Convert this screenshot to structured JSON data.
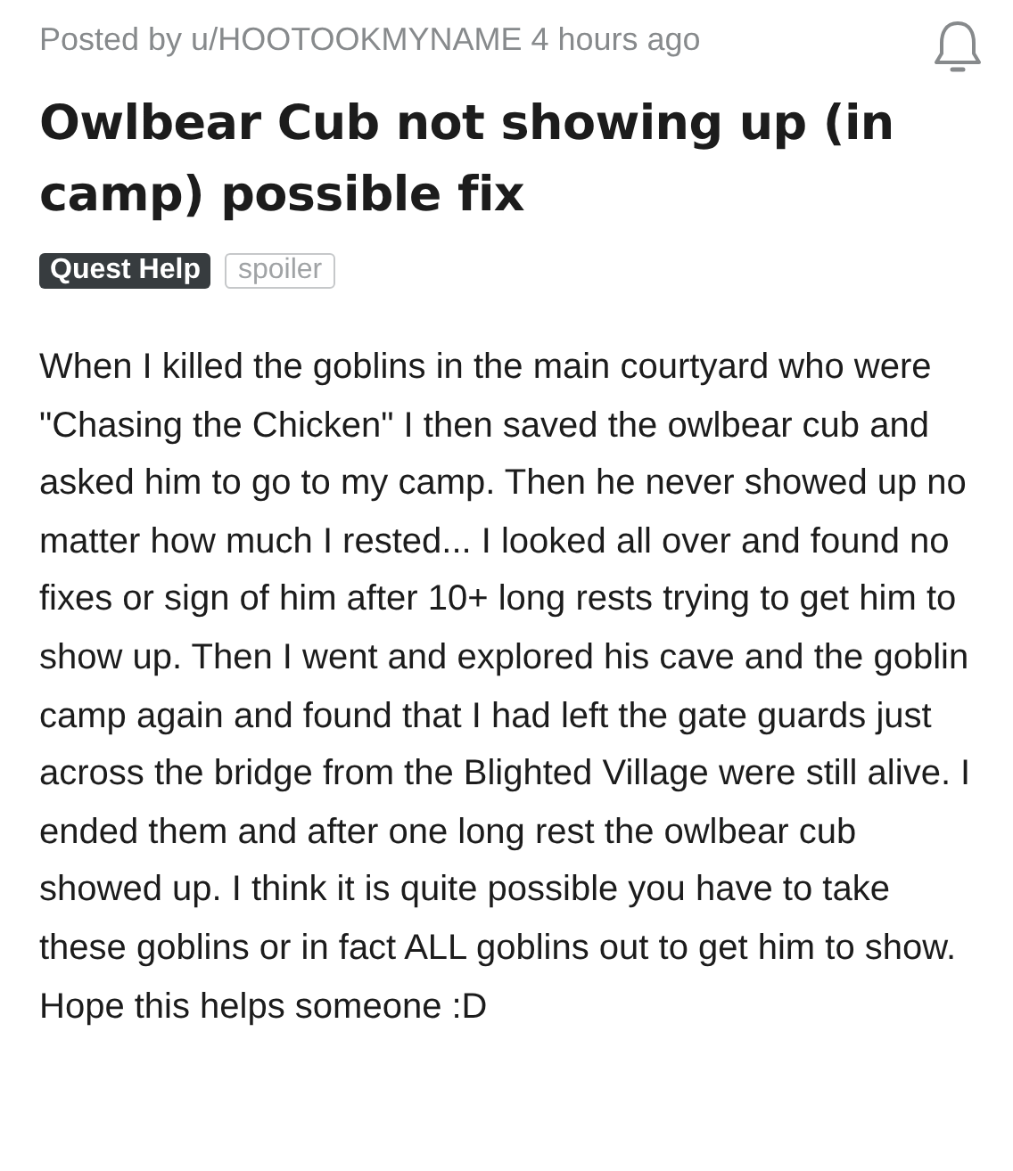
{
  "post": {
    "meta": "Posted by u/HOOTOOKMYNAME 4 hours ago",
    "title": "Owlbear Cub not showing up (in camp) possible fix",
    "flairs": [
      {
        "kind": "flair",
        "label": "Quest Help"
      },
      {
        "kind": "tag",
        "label": "spoiler"
      }
    ],
    "body": "When I killed the goblins in the main courtyard who were \"Chasing the Chicken\" I then saved the owlbear cub and asked him to go to my camp. Then he never showed up no matter how much I rested... I looked all over and found no fixes or sign of him after 10+ long rests trying to get him to show up. Then I went and explored his cave and the goblin camp again and found that I had left the gate guards just across the bridge from the Blighted Village were still alive. I ended them and after one long rest the owlbear cub showed up. I think it is quite possible you have to take these goblins or in fact ALL goblins out to get him to show. Hope this helps someone :D"
  }
}
